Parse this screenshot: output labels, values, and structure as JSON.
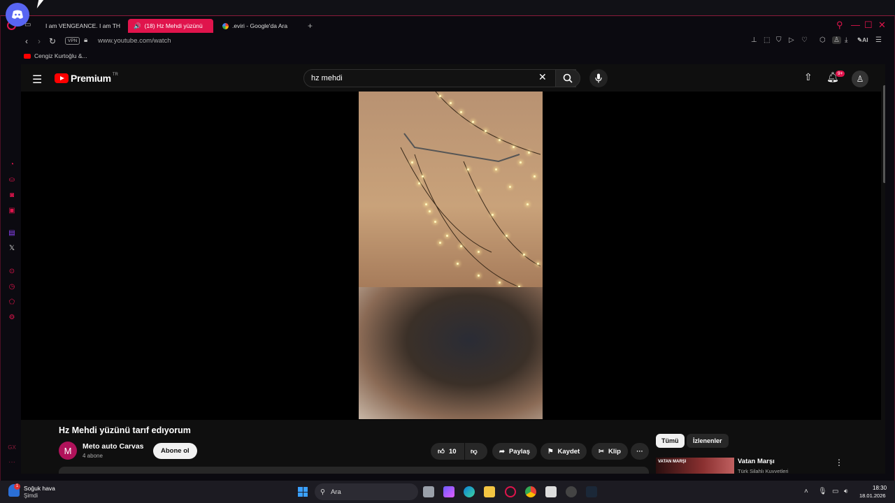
{
  "browser": {
    "tabs": [
      {
        "label": "I am VENGEANCE. I am TH",
        "favicon": "youtube-icon"
      },
      {
        "label": "(18) Hz Mehdi yüzünü",
        "favicon": "speaker-icon",
        "active": true
      },
      {
        "label": ".eviri - Google'da Ara",
        "favicon": "google-icon"
      }
    ],
    "url": "www.youtube.com/watch",
    "vpn_label": "VPN",
    "ai_label": "AI",
    "bookmark": "Cengiz Kurtoğlu &...",
    "accent": "#e0144c"
  },
  "youtube": {
    "logo_text": "Premium",
    "logo_region": "TR",
    "search_query": "hz mehdi",
    "notification_count": "9+",
    "video": {
      "title": "Hz Mehdi yüzünü tarıf edıyorum",
      "channel_initial": "M",
      "channel_name": "Meto auto Carvas",
      "subscribers": "4 abone",
      "subscribe_label": "Abone ol",
      "likes": "10",
      "share_label": "Paylaş",
      "save_label": "Kaydet",
      "clip_label": "Klip"
    },
    "chips": [
      "Tümü",
      "İzlenenler"
    ],
    "recommendation": {
      "thumb_text": "VATAN MARŞI",
      "title": "Vatan Marşı",
      "channel": "Türk Silahlı Kuvvetleri"
    }
  },
  "taskbar": {
    "weather_title": "Soğuk hava",
    "weather_sub": "Şimdi",
    "weather_badge": "1",
    "search_placeholder": "Ara",
    "time": "18:30",
    "date": "18.01.2026"
  }
}
